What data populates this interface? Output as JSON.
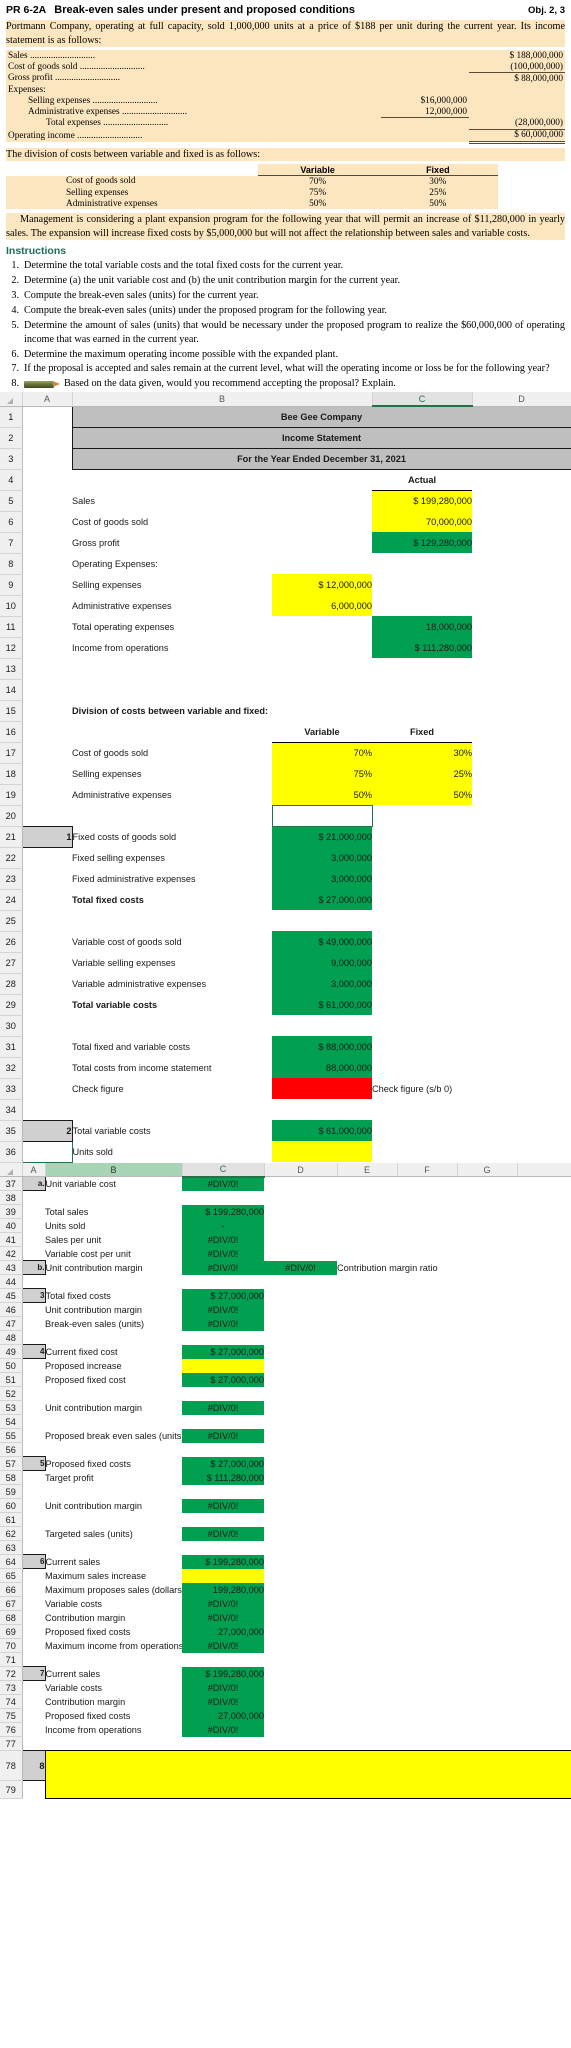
{
  "problem": {
    "id": "PR 6-2A",
    "title": "Break-even sales under present and proposed conditions",
    "obj": "Obj. 2, 3",
    "intro": "Portmann Company, operating at full capacity, sold 1,000,000 units at a price of $188 per unit during the current year. Its income statement is as follows:",
    "income_rows": [
      {
        "label": "Sales",
        "leader": true,
        "indent": 0,
        "col1": "",
        "col2": "$ 188,000,000",
        "rule": ""
      },
      {
        "label": "Cost of goods sold",
        "leader": true,
        "indent": 0,
        "col1": "",
        "col2": "(100,000,000)",
        "rule": "single"
      },
      {
        "label": "Gross profit",
        "leader": true,
        "indent": 0,
        "col1": "",
        "col2": "$  88,000,000",
        "rule": ""
      },
      {
        "label": "Expenses:",
        "leader": false,
        "indent": 0,
        "col1": "",
        "col2": "",
        "rule": ""
      },
      {
        "label": "Selling expenses",
        "leader": true,
        "indent": 1,
        "col1": "$16,000,000",
        "col2": "",
        "rule": ""
      },
      {
        "label": "Administrative expenses",
        "leader": true,
        "indent": 1,
        "col1": "12,000,000",
        "col2": "",
        "rule": "single1"
      },
      {
        "label": "Total expenses",
        "leader": true,
        "indent": 2,
        "col1": "",
        "col2": "(28,000,000)",
        "rule": "single"
      },
      {
        "label": "Operating income",
        "leader": true,
        "indent": 0,
        "col1": "",
        "col2": "$  60,000,000",
        "rule": "double"
      }
    ],
    "division_intro": "The division of costs between variable and fixed is as follows:",
    "division_headers": [
      "Variable",
      "Fixed"
    ],
    "division_rows": [
      {
        "name": "Cost of goods sold",
        "variable": "70%",
        "fixed": "30%"
      },
      {
        "name": "Selling expenses",
        "variable": "75%",
        "fixed": "25%"
      },
      {
        "name": "Administrative expenses",
        "variable": "50%",
        "fixed": "50%"
      }
    ],
    "expansion": "Management is considering a plant expansion program for the following year that will permit an increase of $11,280,000 in yearly sales. The expansion will increase fixed costs by $5,000,000 but will not affect the relationship between sales and variable costs.",
    "instructions_heading": "Instructions",
    "instructions": [
      "Determine the total variable costs and the total fixed costs for the current year.",
      "Determine (a) the unit variable cost and (b) the unit contribution margin for the current year.",
      "Compute the break-even sales (units) for the current year.",
      "Compute the break-even sales (units) under the proposed program for the following year.",
      "Determine the amount of sales (units) that would be necessary under the proposed program to realize the $60,000,000 of operating income that was earned in the current year.",
      "Determine the maximum operating income possible with the expanded plant.",
      "If the proposal is accepted and sales remain at the current level, what will the operating income or loss be for the following year?",
      "Based on the data given, would you recommend accepting the proposal? Explain."
    ]
  },
  "sheet1": {
    "columns": [
      "A",
      "B",
      "C",
      "D",
      "E"
    ],
    "selected_column": "C",
    "title_block": [
      "Bee Gee Company",
      "Income Statement",
      "For the Year Ended December 31, 2021"
    ],
    "actual_header": "Actual",
    "rows": [
      {
        "n": "1",
        "kind": "title",
        "text": "Bee Gee Company"
      },
      {
        "n": "2",
        "kind": "title",
        "text": "Income Statement"
      },
      {
        "n": "3",
        "kind": "title",
        "text": "For the Year Ended December 31, 2021"
      },
      {
        "n": "4",
        "kind": "hdr",
        "a": "",
        "b": "",
        "c": "",
        "d": "Actual"
      },
      {
        "n": "5",
        "kind": "row",
        "a": "",
        "b": "Sales",
        "indent": 0,
        "c": "",
        "d": "$    199,280,000",
        "dfill": "yel"
      },
      {
        "n": "6",
        "kind": "row",
        "a": "",
        "b": "Cost of goods sold",
        "indent": 0,
        "c": "",
        "d": "70,000,000",
        "dfill": "yel"
      },
      {
        "n": "7",
        "kind": "row",
        "a": "",
        "b": "Gross profit",
        "indent": 0,
        "c": "",
        "d": "$    129,280,000",
        "dfill": "grn"
      },
      {
        "n": "8",
        "kind": "row",
        "a": "",
        "b": "Operating Expenses:",
        "indent": 0,
        "c": "",
        "d": ""
      },
      {
        "n": "9",
        "kind": "row",
        "a": "",
        "b": "Selling expenses",
        "indent": 1,
        "c": "$    12,000,000",
        "cfill": "yel",
        "d": ""
      },
      {
        "n": "10",
        "kind": "row",
        "a": "",
        "b": "Administrative expenses",
        "indent": 1,
        "c": "6,000,000",
        "cfill": "yel",
        "d": ""
      },
      {
        "n": "11",
        "kind": "row",
        "a": "",
        "b": "Total operating expenses",
        "indent": 2,
        "c": "",
        "d": "18,000,000",
        "dfill": "grn"
      },
      {
        "n": "12",
        "kind": "row",
        "a": "",
        "b": "Income from operations",
        "indent": 0,
        "c": "",
        "d": "$    111,280,000",
        "dfill": "grn"
      },
      {
        "n": "13",
        "kind": "row",
        "a": "",
        "b": "",
        "c": "",
        "d": ""
      },
      {
        "n": "14",
        "kind": "row",
        "a": "",
        "b": "",
        "c": "",
        "d": ""
      },
      {
        "n": "15",
        "kind": "row",
        "a": "",
        "b": "Division of costs between variable and fixed:",
        "bold": true,
        "c": "",
        "d": ""
      },
      {
        "n": "16",
        "kind": "vfhdr",
        "a": "",
        "b": "",
        "c": "Variable",
        "d": "Fixed"
      },
      {
        "n": "17",
        "kind": "row",
        "a": "",
        "b": "Cost of goods sold",
        "c": "70%",
        "cfill": "yel",
        "cal": "right",
        "d": "30%",
        "dfill": "yel"
      },
      {
        "n": "18",
        "kind": "row",
        "a": "",
        "b": "Selling expenses",
        "c": "75%",
        "cfill": "yel",
        "cal": "right",
        "d": "25%",
        "dfill": "yel"
      },
      {
        "n": "19",
        "kind": "row",
        "a": "",
        "b": "Administrative expenses",
        "c": "50%",
        "cfill": "yel",
        "cal": "right",
        "d": "50%",
        "dfill": "yel"
      },
      {
        "n": "20",
        "kind": "sel",
        "a": "",
        "b": "",
        "c": "",
        "d": ""
      },
      {
        "n": "21",
        "kind": "row",
        "a": "1",
        "abox": true,
        "b": "Fixed costs of goods sold",
        "c": "$    21,000,000",
        "cfill": "grn",
        "d": ""
      },
      {
        "n": "22",
        "kind": "row",
        "a": "",
        "b": "Fixed selling expenses",
        "c": "3,000,000",
        "cfill": "grn",
        "d": ""
      },
      {
        "n": "23",
        "kind": "row",
        "a": "",
        "b": "Fixed administrative expenses",
        "c": "3,000,000",
        "cfill": "grn",
        "d": ""
      },
      {
        "n": "24",
        "kind": "row",
        "a": "",
        "b": "Total fixed costs",
        "bold": true,
        "c": "$    27,000,000",
        "cfill": "grn",
        "d": ""
      },
      {
        "n": "25",
        "kind": "row",
        "a": "",
        "b": "",
        "c": "",
        "d": ""
      },
      {
        "n": "26",
        "kind": "row",
        "a": "",
        "b": "Variable cost of goods sold",
        "c": "$    49,000,000",
        "cfill": "grn",
        "d": ""
      },
      {
        "n": "27",
        "kind": "row",
        "a": "",
        "b": "Variable selling expenses",
        "c": "9,000,000",
        "cfill": "grn",
        "d": ""
      },
      {
        "n": "28",
        "kind": "row",
        "a": "",
        "b": "Variable administrative expenses",
        "c": "3,000,000",
        "cfill": "grn",
        "d": ""
      },
      {
        "n": "29",
        "kind": "row",
        "a": "",
        "b": "Total variable costs",
        "bold": true,
        "c": "$    61,000,000",
        "cfill": "grn",
        "d": ""
      },
      {
        "n": "30",
        "kind": "row",
        "a": "",
        "b": "",
        "c": "",
        "d": ""
      },
      {
        "n": "31",
        "kind": "row",
        "a": "",
        "b": "Total fixed and variable costs",
        "c": "$    88,000,000",
        "cfill": "grn",
        "d": ""
      },
      {
        "n": "32",
        "kind": "row",
        "a": "",
        "b": "Total costs from income statement",
        "c": "88,000,000",
        "cfill": "grn",
        "d": ""
      },
      {
        "n": "33",
        "kind": "row",
        "a": "",
        "b": "Check figure",
        "c": "-",
        "cfill": "red",
        "d": "Check figure (s/b 0)"
      },
      {
        "n": "34",
        "kind": "row",
        "a": "",
        "b": "",
        "c": "",
        "d": ""
      },
      {
        "n": "35",
        "kind": "row",
        "a": "2",
        "abox": true,
        "b": "Total variable costs",
        "c": "$    61,000,000",
        "cfill": "grn",
        "d": ""
      },
      {
        "n": "36",
        "kind": "row",
        "a": "",
        "abox2": true,
        "b": "Units sold",
        "c": "",
        "cfill": "yel",
        "d": ""
      }
    ]
  },
  "sheet2": {
    "columns": [
      "A",
      "B",
      "C",
      "D",
      "E",
      "F",
      "G"
    ],
    "selected_column": "C",
    "green_column": "B",
    "rows": [
      {
        "n": "37",
        "a": "a.",
        "abox": true,
        "b": "Unit variable cost",
        "c": "#DIV/0!",
        "cfill": "grn",
        "cal": "ctr",
        "d": "",
        "e": ""
      },
      {
        "n": "38",
        "a": "",
        "b": "",
        "c": "",
        "d": "",
        "e": ""
      },
      {
        "n": "39",
        "a": "",
        "b": "Total sales",
        "indent": 1,
        "c": "$  199,280,000",
        "cfill": "grn",
        "d": "",
        "e": ""
      },
      {
        "n": "40",
        "a": "",
        "b": "Units sold",
        "indent": 1,
        "c": "-",
        "cfill": "grn",
        "cal": "ctr",
        "d": "",
        "e": ""
      },
      {
        "n": "41",
        "a": "",
        "b": "Sales per unit",
        "indent": 1,
        "c": "#DIV/0!",
        "cfill": "grn",
        "cal": "ctr",
        "d": "",
        "e": ""
      },
      {
        "n": "42",
        "a": "",
        "b": "Variable cost per unit",
        "indent": 1,
        "c": "#DIV/0!",
        "cfill": "grn",
        "cal": "ctr",
        "d": "",
        "e": ""
      },
      {
        "n": "43",
        "a": "b.",
        "abox": true,
        "b": "Unit contribution margin",
        "c": "#DIV/0!",
        "cfill": "grn",
        "cal": "ctr",
        "d": "#DIV/0!",
        "dfill": "grn",
        "dal": "ctr",
        "e": "Contribution margin ratio"
      },
      {
        "n": "44",
        "a": "",
        "b": "",
        "c": "",
        "d": "",
        "e": ""
      },
      {
        "n": "45",
        "a": "3",
        "abox": true,
        "b": "Total fixed costs",
        "c": "$    27,000,000",
        "cfill": "grn",
        "d": "",
        "e": ""
      },
      {
        "n": "46",
        "a": "",
        "b": "Unit contribution margin",
        "indent": 1,
        "c": "#DIV/0!",
        "cfill": "grn",
        "cal": "ctr",
        "d": "",
        "e": ""
      },
      {
        "n": "47",
        "a": "",
        "b": "Break-even sales (units)",
        "indent": 1,
        "c": "#DIV/0!",
        "cfill": "grn",
        "cal": "ctr",
        "d": "",
        "e": ""
      },
      {
        "n": "48",
        "a": "",
        "b": "",
        "c": "",
        "d": "",
        "e": ""
      },
      {
        "n": "49",
        "a": "4",
        "abox": true,
        "b": "Current fixed cost",
        "c": "$    27,000,000",
        "cfill": "grn",
        "d": "",
        "e": ""
      },
      {
        "n": "50",
        "a": "",
        "b": "Proposed increase",
        "indent": 1,
        "c": "",
        "cfill": "yel",
        "d": "",
        "e": ""
      },
      {
        "n": "51",
        "a": "",
        "b": "Proposed fixed cost",
        "indent": 1,
        "c": "$    27,000,000",
        "cfill": "grn",
        "d": "",
        "e": ""
      },
      {
        "n": "52",
        "a": "",
        "b": "",
        "c": "",
        "d": "",
        "e": ""
      },
      {
        "n": "53",
        "a": "",
        "b": "Unit contribution margin",
        "indent": 1,
        "c": "#DIV/0!",
        "cfill": "grn",
        "cal": "ctr",
        "d": "",
        "e": ""
      },
      {
        "n": "54",
        "a": "",
        "b": "",
        "c": "",
        "d": "",
        "e": ""
      },
      {
        "n": "55",
        "a": "",
        "b": "Proposed break even sales (units)",
        "indent": 1,
        "c": "#DIV/0!",
        "cfill": "grn",
        "cal": "ctr",
        "d": "",
        "e": ""
      },
      {
        "n": "56",
        "a": "",
        "b": "",
        "c": "",
        "d": "",
        "e": ""
      },
      {
        "n": "57",
        "a": "5",
        "abox": true,
        "b": "Proposed fixed costs",
        "c": "$    27,000,000",
        "cfill": "grn",
        "d": "",
        "e": ""
      },
      {
        "n": "58",
        "a": "",
        "b": "Target profit",
        "indent": 1,
        "c": "$  111,280,000",
        "cfill": "grn",
        "d": "",
        "e": ""
      },
      {
        "n": "59",
        "a": "",
        "b": "",
        "c": "",
        "d": "",
        "e": ""
      },
      {
        "n": "60",
        "a": "",
        "b": "Unit contribution margin",
        "indent": 1,
        "c": "#DIV/0!",
        "cfill": "grn",
        "cal": "ctr",
        "d": "",
        "e": ""
      },
      {
        "n": "61",
        "a": "",
        "b": "",
        "c": "",
        "d": "",
        "e": ""
      },
      {
        "n": "62",
        "a": "",
        "b": "Targeted sales (units)",
        "indent": 1,
        "c": "#DIV/0!",
        "cfill": "grn",
        "cal": "ctr",
        "d": "",
        "e": ""
      },
      {
        "n": "63",
        "a": "",
        "b": "",
        "c": "",
        "d": "",
        "e": ""
      },
      {
        "n": "64",
        "a": "6",
        "abox": true,
        "b": "Current sales",
        "c": "$  199,280,000",
        "cfill": "grn",
        "d": "",
        "e": ""
      },
      {
        "n": "65",
        "a": "",
        "b": "Maximum sales increase",
        "indent": 1,
        "c": "",
        "cfill": "yel",
        "d": "",
        "e": ""
      },
      {
        "n": "66",
        "a": "",
        "b": "Maximum proposes sales (dollars)",
        "indent": 1,
        "c": "199,280,000",
        "cfill": "grn",
        "d": "",
        "e": ""
      },
      {
        "n": "67",
        "a": "",
        "b": "Variable costs",
        "indent": 1,
        "c": "#DIV/0!",
        "cfill": "grn",
        "cal": "ctr",
        "d": "",
        "e": ""
      },
      {
        "n": "68",
        "a": "",
        "b": "Contribution margin",
        "indent": 1,
        "c": "#DIV/0!",
        "cfill": "grn",
        "cal": "ctr",
        "d": "",
        "e": ""
      },
      {
        "n": "69",
        "a": "",
        "b": "Proposed fixed costs",
        "indent": 1,
        "c": "27,000,000",
        "cfill": "grn",
        "d": "",
        "e": ""
      },
      {
        "n": "70",
        "a": "",
        "b": "Maximum income from operations",
        "indent": 1,
        "c": "#DIV/0!",
        "cfill": "grn",
        "cal": "ctr",
        "d": "",
        "e": ""
      },
      {
        "n": "71",
        "a": "",
        "b": "",
        "c": "",
        "d": "",
        "e": ""
      },
      {
        "n": "72",
        "a": "7",
        "abox": true,
        "b": "Current sales",
        "c": "$  199,280,000",
        "cfill": "grn",
        "d": "",
        "e": ""
      },
      {
        "n": "73",
        "a": "",
        "b": "Variable costs",
        "indent": 1,
        "c": "#DIV/0!",
        "cfill": "grn",
        "cal": "ctr",
        "d": "",
        "e": ""
      },
      {
        "n": "74",
        "a": "",
        "b": "Contribution margin",
        "indent": 1,
        "c": "#DIV/0!",
        "cfill": "grn",
        "cal": "ctr",
        "d": "",
        "e": ""
      },
      {
        "n": "75",
        "a": "",
        "b": "Proposed fixed costs",
        "indent": 1,
        "c": "27,000,000",
        "cfill": "grn",
        "d": "",
        "e": ""
      },
      {
        "n": "76",
        "a": "",
        "b": "Income from operations",
        "indent": 1,
        "c": "#DIV/0!",
        "cfill": "grn",
        "cal": "ctr",
        "d": "",
        "e": ""
      },
      {
        "n": "77",
        "a": "",
        "b": "",
        "c": "",
        "d": "",
        "e": ""
      },
      {
        "n": "78",
        "a": "8",
        "abox": true,
        "b": "",
        "c": "",
        "d": "",
        "e": "",
        "answer": true
      },
      {
        "n": "79",
        "a": "",
        "b": "",
        "c": "",
        "d": "",
        "e": ""
      }
    ]
  },
  "colors": {
    "yellow": "#ffff00",
    "green": "#00a050",
    "red": "#ff0000",
    "gray": "#bfbfbf",
    "excel_green": "#217346",
    "highlight": "#fbe6c0"
  }
}
